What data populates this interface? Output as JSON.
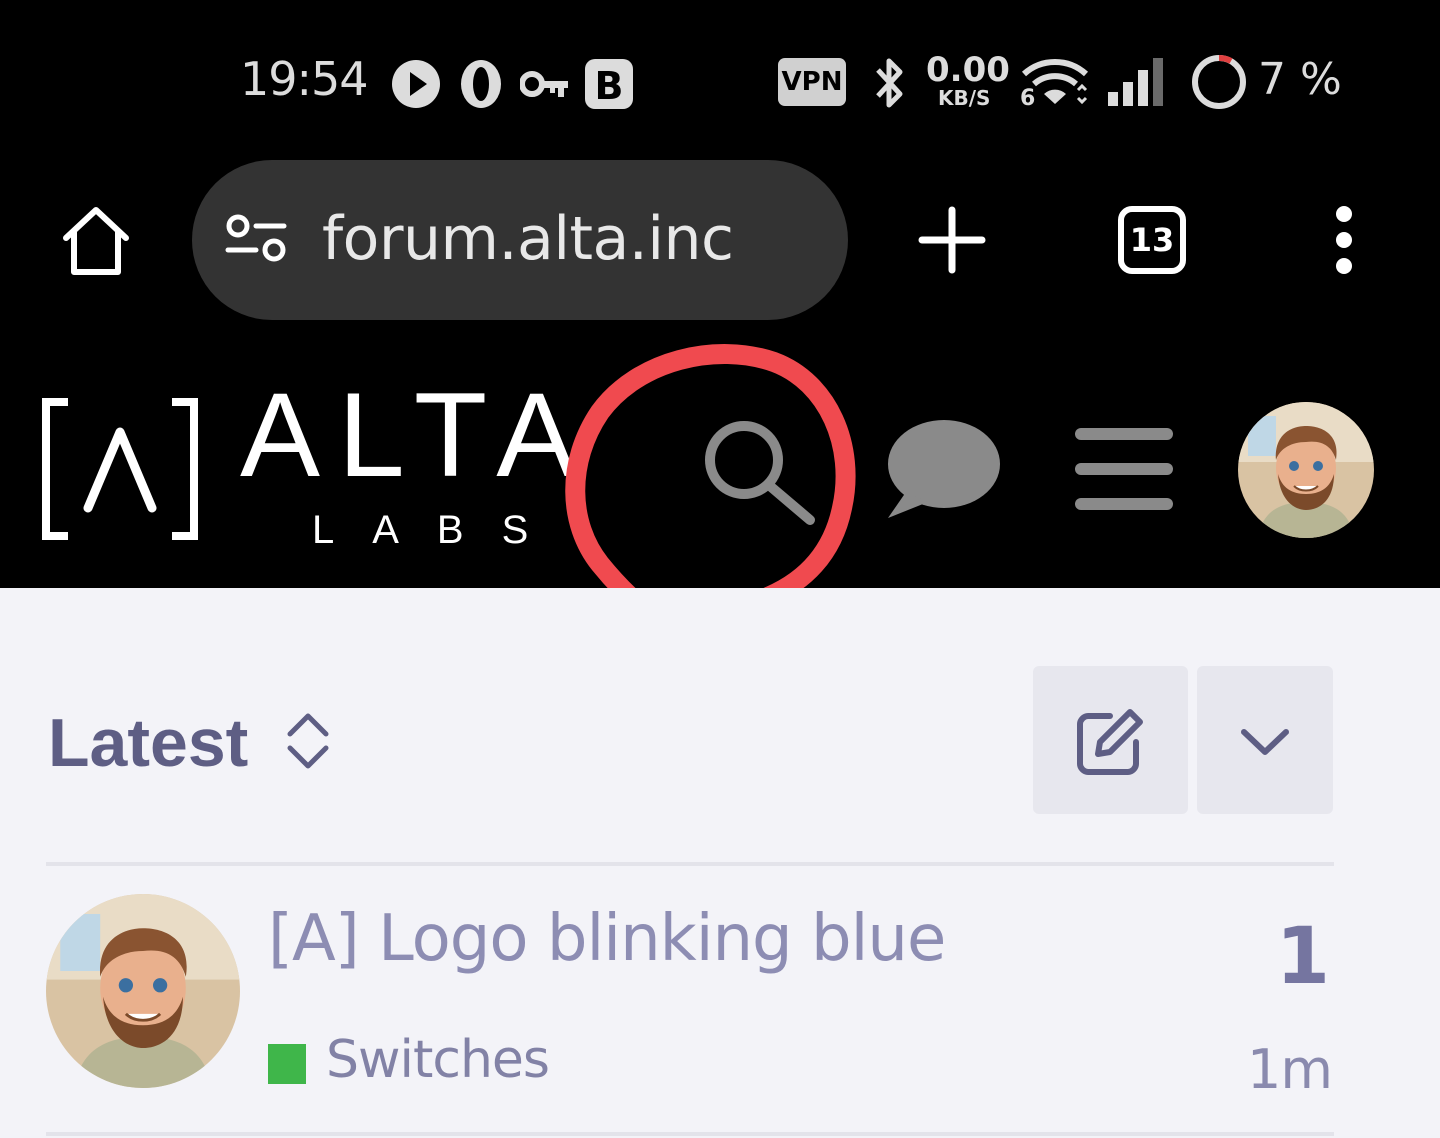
{
  "status_bar": {
    "time": "19:54",
    "vpn": "VPN",
    "speed_value": "0.00",
    "speed_unit": "KB/S",
    "wifi_generation": "6",
    "battery": "7 %",
    "icons": [
      "play-icon",
      "opera-icon",
      "key-icon",
      "brave-b-icon",
      "bluetooth-icon",
      "wifi-icon",
      "signal-icon",
      "battery-ring-icon"
    ]
  },
  "browser": {
    "url": "forum.alta.inc",
    "tab_count": "13",
    "icons": [
      "home-icon",
      "site-settings-icon",
      "new-tab-icon",
      "tabs-icon",
      "more-menu-icon"
    ]
  },
  "site_header": {
    "logo_word": "ALTA",
    "logo_sub": "LABS",
    "icons": [
      "search-icon",
      "chat-icon",
      "hamburger-menu-icon",
      "user-avatar"
    ],
    "annotation_color": "#f04a4f"
  },
  "listing": {
    "filter_label": "Latest",
    "icons": [
      "sort-chevrons-icon",
      "new-topic-icon",
      "chevron-down-icon"
    ]
  },
  "topics": [
    {
      "title": "[A] Logo blinking blue",
      "category": "Switches",
      "category_color": "#3fb64a",
      "replies": "1",
      "age": "1m"
    }
  ]
}
